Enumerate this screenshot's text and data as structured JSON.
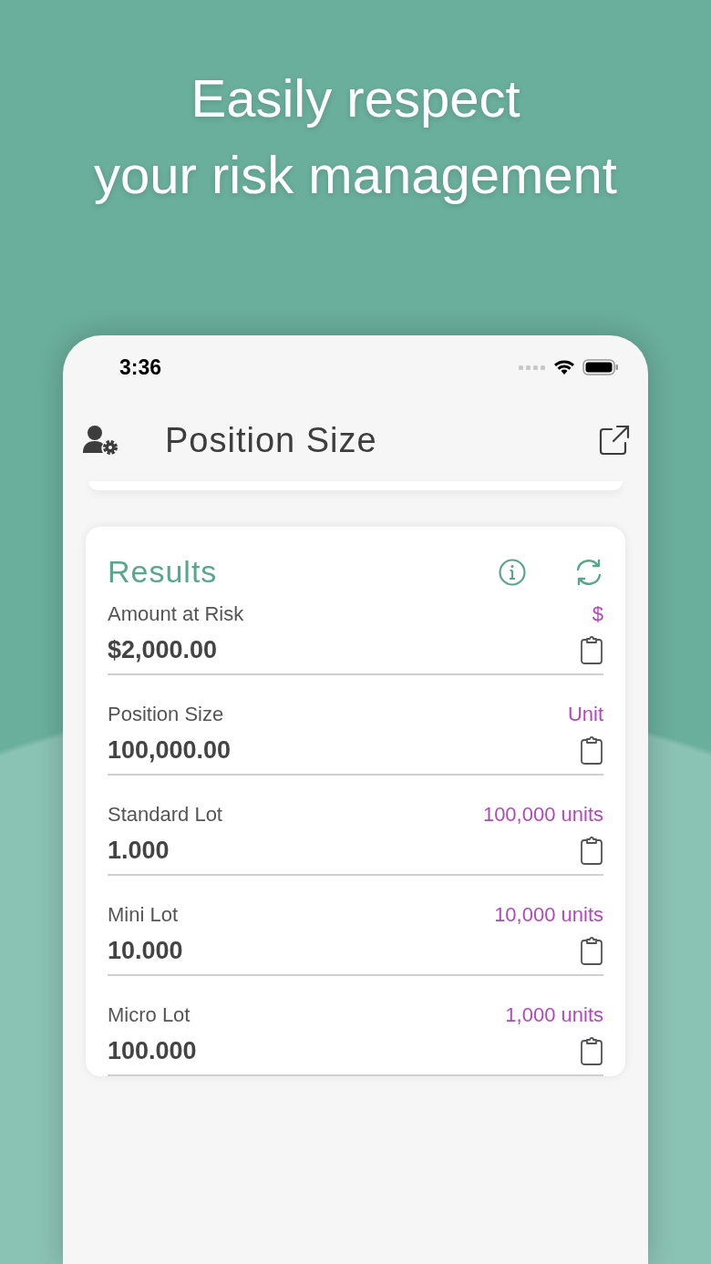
{
  "headline": [
    "Easily respect",
    "your risk management"
  ],
  "status_bar": {
    "time": "3:36"
  },
  "nav_bar": {
    "title": "Position Size"
  },
  "results": {
    "title": "Results",
    "rows": [
      {
        "label": "Amount at Risk",
        "unit": "$",
        "value": "$2,000.00"
      },
      {
        "label": "Position Size",
        "unit": "Unit",
        "value": "100,000.00"
      },
      {
        "label": "Standard Lot",
        "unit": "100,000 units",
        "value": "1.000"
      },
      {
        "label": "Mini Lot",
        "unit": "10,000 units",
        "value": "10.000"
      },
      {
        "label": "Micro Lot",
        "unit": "1,000 units",
        "value": "100.000"
      }
    ]
  }
}
